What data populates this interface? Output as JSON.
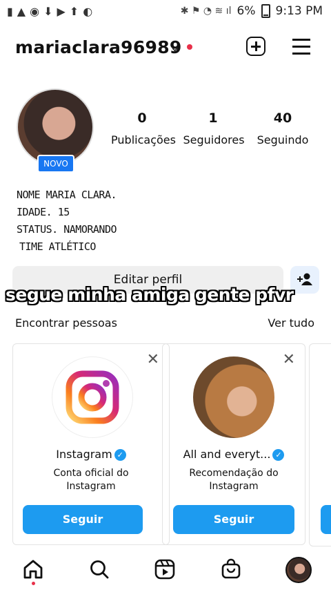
{
  "status_bar": {
    "battery": "6%",
    "time": "9:13 PM"
  },
  "header": {
    "username": "mariaclara96989"
  },
  "profile": {
    "badge": "NOVO",
    "stats": [
      {
        "value": "0",
        "label": "Publicações"
      },
      {
        "value": "1",
        "label": "Seguidores"
      },
      {
        "value": "40",
        "label": "Seguindo"
      }
    ],
    "bio": [
      "NOME MARIA CLARA.",
      "IDADE. 15",
      "STATUS. NAMORANDO",
      "TIME ATLÉTICO"
    ]
  },
  "actions": {
    "edit_label": "Editar perfil"
  },
  "caption": "segue minha amiga gente pfvr",
  "discover": {
    "title": "Encontrar pessoas",
    "see_all": "Ver tudo",
    "cards": [
      {
        "name": "Instagram",
        "desc_line1": "Conta oficial do",
        "desc_line2": "Instagram",
        "button": "Seguir"
      },
      {
        "name": "All and everyt...",
        "desc_line1": "Recomendação do",
        "desc_line2": "Instagram",
        "button": "Seguir"
      }
    ]
  },
  "colors": {
    "accent": "#1d9bf0",
    "badge_blue": "#1877f2",
    "notification": "#e8304a"
  },
  "icons": [
    "home-icon",
    "search-icon",
    "reels-icon",
    "shop-icon",
    "profile-avatar"
  ]
}
